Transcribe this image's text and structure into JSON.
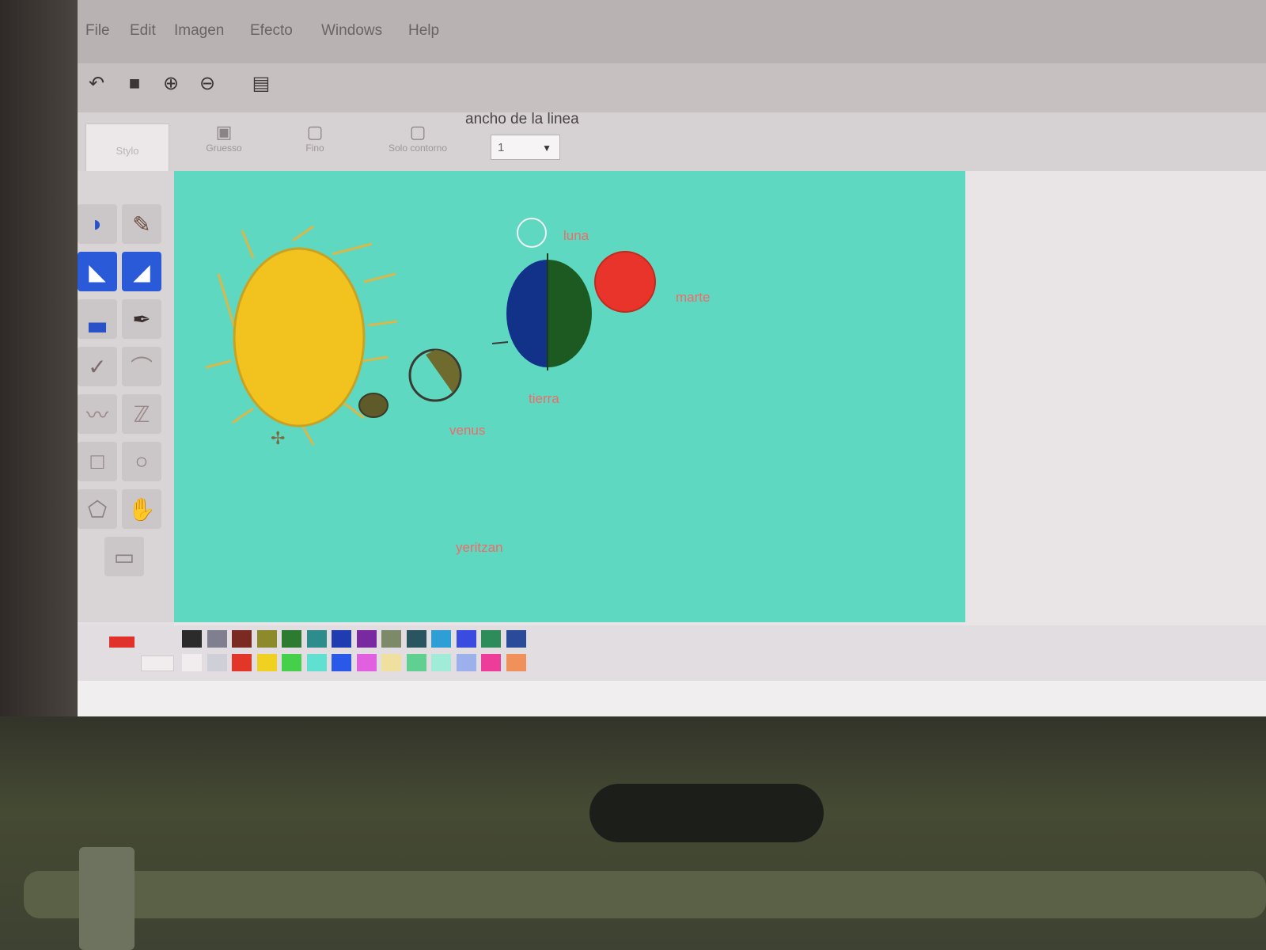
{
  "menu": {
    "items": [
      "File",
      "Edit",
      "Imagen",
      "Efecto",
      "Windows",
      "Help"
    ]
  },
  "toolbar": {
    "icons": [
      "undo-icon",
      "open-icon",
      "zoom-in-icon",
      "zoom-out-icon",
      "print-icon"
    ]
  },
  "options": {
    "style_label": "Stylo",
    "buttons": [
      "Gruesso",
      "Fino",
      "Solo contorno"
    ],
    "line_width_label": "ancho de la linea",
    "line_width_value": "1"
  },
  "tools": [
    "paint-bucket-icon",
    "pencil-icon",
    "select-icon",
    "select-free-icon",
    "fill-icon",
    "brush-icon",
    "eraser-icon",
    "airbrush-icon",
    "line-icon",
    "curve-icon",
    "rectangle-icon",
    "ellipse-icon",
    "polygon-icon",
    "color-picker-icon",
    "text-icon"
  ],
  "canvas": {
    "labels": {
      "luna": "luna",
      "marte": "marte",
      "tierra": "tierra",
      "venus": "venus",
      "yeritzan": "yeritzan"
    },
    "colors": {
      "background": "#5fd8c2",
      "sun": "#f2c31f",
      "earth_blue": "#12328a",
      "earth_green": "#1c5a22",
      "mars": "#e8342a",
      "venus": "#6f6b2f",
      "mercury": "#5f5a2a"
    }
  },
  "palette": {
    "current_color": "#e0312a",
    "row1": [
      "#2b2b2b",
      "#7f7f90",
      "#7a2a22",
      "#8c8a2a",
      "#2d7a31",
      "#2f8c8c",
      "#1f3db0",
      "#7a2aa0",
      "#7c8a6a",
      "#2a5560",
      "#2e9fd6",
      "#3a4ce0",
      "#2e8c5a",
      "#2a4a9a"
    ],
    "row2": [
      "#f1eced",
      "#cfcfd8",
      "#e23628",
      "#f0d020",
      "#44d04a",
      "#60e0d0",
      "#2a58e8",
      "#e060e0",
      "#f0e0a0",
      "#60d090",
      "#a0ecd8",
      "#9cb0ec",
      "#ee3c9a",
      "#f0905a"
    ]
  }
}
